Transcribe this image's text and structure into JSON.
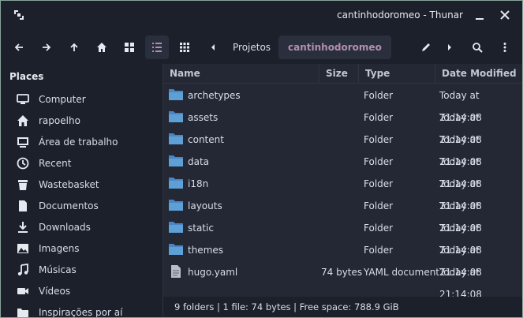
{
  "window": {
    "title": "cantinhodoromeo - Thunar"
  },
  "toolbar": {
    "breadcrumbs": [
      "Projetos",
      "cantinhodoromeo"
    ]
  },
  "sidebar": {
    "header": "Places",
    "items": [
      {
        "label": "Computer",
        "icon": "computer-icon"
      },
      {
        "label": "rapoelho",
        "icon": "home-icon"
      },
      {
        "label": "Área de trabalho",
        "icon": "desktop-icon"
      },
      {
        "label": "Recent",
        "icon": "clock-icon"
      },
      {
        "label": "Wastebasket",
        "icon": "trash-icon"
      },
      {
        "label": "Documentos",
        "icon": "document-icon"
      },
      {
        "label": "Downloads",
        "icon": "download-icon"
      },
      {
        "label": "Imagens",
        "icon": "image-icon"
      },
      {
        "label": "Músicas",
        "icon": "music-icon"
      },
      {
        "label": "Vídeos",
        "icon": "video-icon"
      },
      {
        "label": "Inspirações por aí",
        "icon": "folder-icon"
      }
    ]
  },
  "columns": {
    "name": "Name",
    "size": "Size",
    "type": "Type",
    "modified": "Date Modified"
  },
  "files": [
    {
      "name": "archetypes",
      "size": "",
      "type": "Folder",
      "modified": "Today at 21:14:08",
      "kind": "folder"
    },
    {
      "name": "assets",
      "size": "",
      "type": "Folder",
      "modified": "Today at 21:14:08",
      "kind": "folder"
    },
    {
      "name": "content",
      "size": "",
      "type": "Folder",
      "modified": "Today at 21:14:08",
      "kind": "folder"
    },
    {
      "name": "data",
      "size": "",
      "type": "Folder",
      "modified": "Today at 21:14:08",
      "kind": "folder"
    },
    {
      "name": "i18n",
      "size": "",
      "type": "Folder",
      "modified": "Today at 21:14:08",
      "kind": "folder"
    },
    {
      "name": "layouts",
      "size": "",
      "type": "Folder",
      "modified": "Today at 21:14:08",
      "kind": "folder"
    },
    {
      "name": "static",
      "size": "",
      "type": "Folder",
      "modified": "Today at 21:14:08",
      "kind": "folder"
    },
    {
      "name": "themes",
      "size": "",
      "type": "Folder",
      "modified": "Today at 21:14:08",
      "kind": "folder"
    },
    {
      "name": "hugo.yaml",
      "size": "74 bytes",
      "type": "YAML document",
      "modified": "Today at 21:14:08",
      "kind": "file"
    }
  ],
  "status": "9 folders  |  1 file: 74 bytes  |  Free space: 788.9 GiB",
  "colors": {
    "accent": "#b48ead",
    "folder": "#5e9fd6",
    "background": "#232834"
  }
}
